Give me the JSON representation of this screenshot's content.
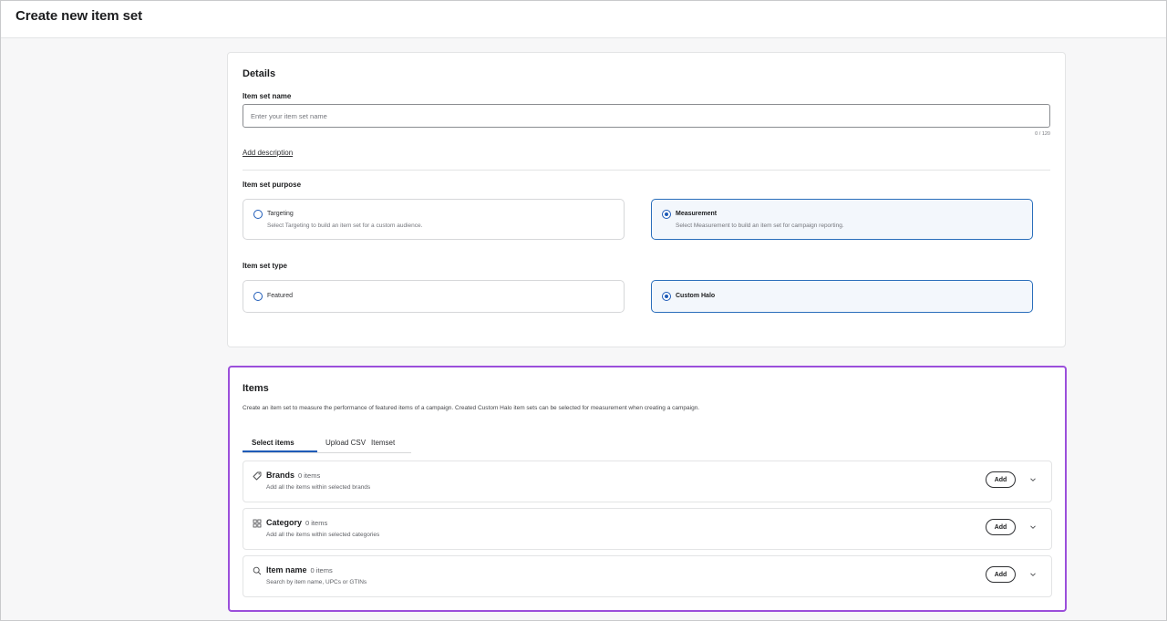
{
  "header": {
    "title": "Create new item set"
  },
  "details": {
    "title": "Details",
    "name_label": "Item set name",
    "name_placeholder": "Enter your item set name",
    "name_value": "",
    "char_count": "0 / 120",
    "add_description": "Add description",
    "purpose_label": "Item set purpose",
    "purpose_options": [
      {
        "title": "Targeting",
        "desc": "Select Targeting to build an item set for a custom audience.",
        "selected": false
      },
      {
        "title": "Measurement",
        "desc": "Select Measurement to build an item set for campaign reporting.",
        "selected": true
      }
    ],
    "type_label": "Item set type",
    "type_options": [
      {
        "title": "Featured",
        "selected": false
      },
      {
        "title": "Custom Halo",
        "selected": true
      }
    ]
  },
  "items": {
    "title": "Items",
    "description": "Create an item set to measure the performance of featured items of a campaign. Created Custom Halo item sets can be selected for measurement when creating a campaign.",
    "tabs": [
      {
        "label": "Select items",
        "active": true
      },
      {
        "label": "Upload CSV",
        "active": false
      },
      {
        "label": "Itemset",
        "active": false
      }
    ],
    "rows": [
      {
        "icon": "tag-icon",
        "title": "Brands",
        "count": "0 items",
        "desc": "Add all the items within selected brands",
        "add_label": "Add"
      },
      {
        "icon": "grid-icon",
        "title": "Category",
        "count": "0 items",
        "desc": "Add all the items within selected categories",
        "add_label": "Add"
      },
      {
        "icon": "search-icon",
        "title": "Item name",
        "count": "0 items",
        "desc": "Search by item name, UPCs or GTINs",
        "add_label": "Add"
      }
    ]
  },
  "colors": {
    "accent": "#1e5bb8",
    "highlight_border": "#9b4fdb",
    "selected_bg": "#f3f7fc"
  }
}
